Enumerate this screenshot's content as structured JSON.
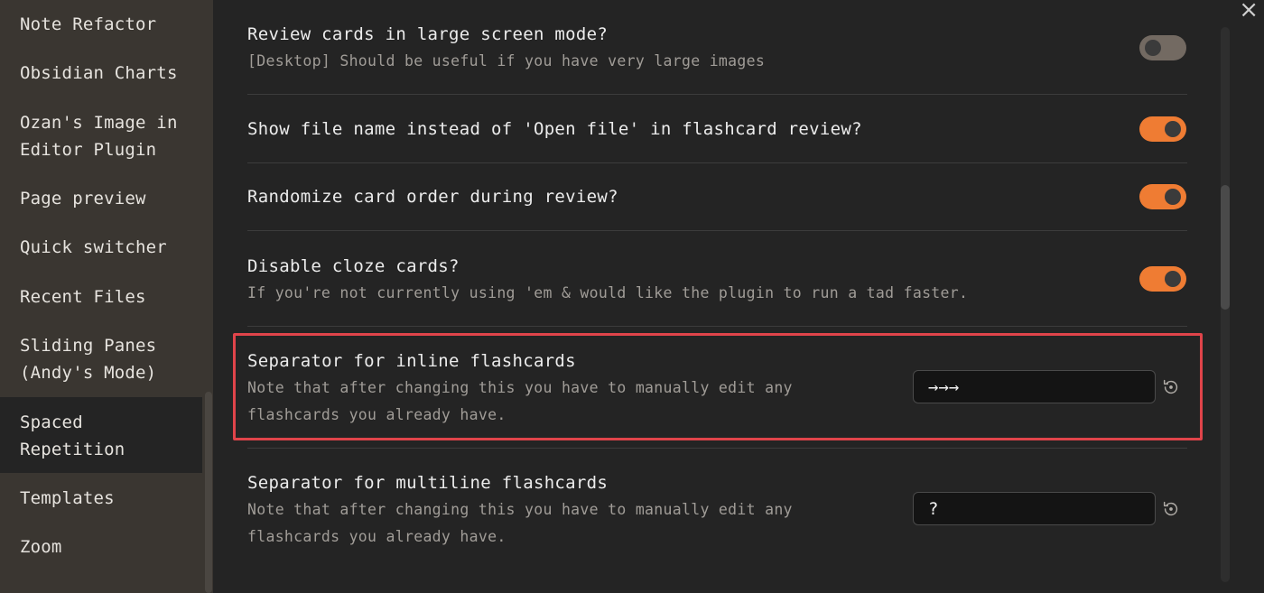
{
  "sidebar": {
    "items": [
      {
        "label_lines": [
          "Note Refactor"
        ],
        "active": false
      },
      {
        "label_lines": [
          "Obsidian Charts"
        ],
        "active": false
      },
      {
        "label_lines": [
          "Ozan's Image in",
          "Editor Plugin"
        ],
        "active": false
      },
      {
        "label_lines": [
          "Page preview"
        ],
        "active": false
      },
      {
        "label_lines": [
          "Quick switcher"
        ],
        "active": false
      },
      {
        "label_lines": [
          "Recent Files"
        ],
        "active": false
      },
      {
        "label_lines": [
          "Sliding Panes",
          "(Andy's Mode)"
        ],
        "active": false
      },
      {
        "label_lines": [
          "Spaced",
          "Repetition"
        ],
        "active": true
      },
      {
        "label_lines": [
          "Templates"
        ],
        "active": false
      },
      {
        "label_lines": [
          "Zoom"
        ],
        "active": false
      }
    ]
  },
  "close_icon": "×",
  "settings": {
    "large_screen": {
      "name": "Review cards in large screen mode?",
      "desc": "[Desktop] Should be useful if you have very large images",
      "enabled": false
    },
    "show_file_name": {
      "name": "Show file name instead of 'Open file' in flashcard review?",
      "enabled": true
    },
    "randomize": {
      "name": "Randomize card order during review?",
      "enabled": true
    },
    "disable_cloze": {
      "name": "Disable cloze cards?",
      "desc": "If you're not currently using 'em & would like the plugin to run a tad faster.",
      "enabled": true
    },
    "inline_separator": {
      "name": "Separator for inline flashcards",
      "desc_line1": "Note that after changing this you have to manually edit any",
      "desc_line2": "flashcards you already have.",
      "value": "→→→",
      "reset_icon": "reset-icon"
    },
    "multiline_separator": {
      "name": "Separator for multiline flashcards",
      "desc_line1": "Note that after changing this you have to manually edit any",
      "desc_line2": "flashcards you already have.",
      "value": "?",
      "reset_icon": "reset-icon"
    }
  },
  "colors": {
    "accent": "#ef7c33",
    "highlight": "#e0444a",
    "sidebar_bg": "#3a3631",
    "main_bg": "#242424"
  }
}
